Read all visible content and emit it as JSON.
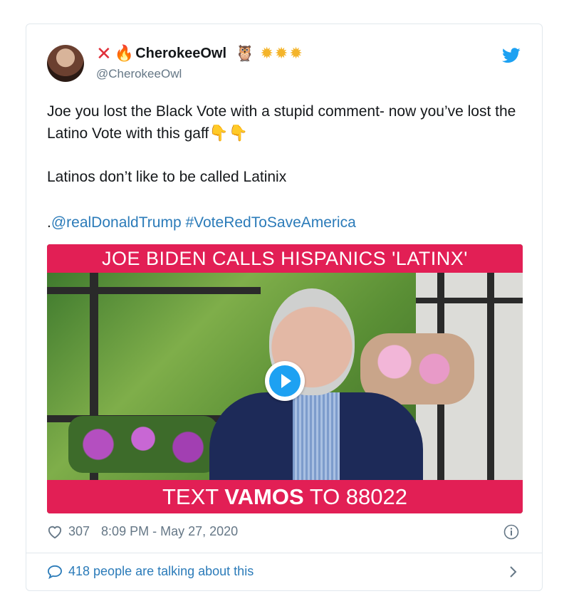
{
  "author": {
    "display_name": "CherokeeOwl",
    "handle": "@CherokeeOwl",
    "name_emojis": [
      "cross-mark",
      "fire",
      "owl",
      "glowing-star",
      "glowing-star",
      "glowing-star"
    ]
  },
  "tweet": {
    "line1": "Joe you lost the Black Vote with a stupid comment- now you’ve lost the Latino Vote with this gaff",
    "line1_emojis": [
      "backhand-index-pointing-down",
      "backhand-index-pointing-down"
    ],
    "line2": "Latinos don’t like to be called Latinix",
    "link_prefix": ".",
    "mention": "@realDonaldTrump",
    "hashtag": "#VoteRedToSaveAmerica"
  },
  "media": {
    "top_banner": "JOE BIDEN CALLS HISPANICS 'LATINX'",
    "bottom_banner_pre": "TEXT ",
    "bottom_banner_bold": "VAMOS",
    "bottom_banner_post": " TO 88022",
    "play_icon": "play-icon"
  },
  "stats": {
    "likes": "307",
    "timestamp": "8:09 PM - May 27, 2020"
  },
  "footer": {
    "talking": "418 people are talking about this"
  },
  "colors": {
    "link": "#2b7bb9",
    "twitter_blue": "#1da1f2",
    "banner": "#e21f55",
    "muted": "#657786"
  }
}
